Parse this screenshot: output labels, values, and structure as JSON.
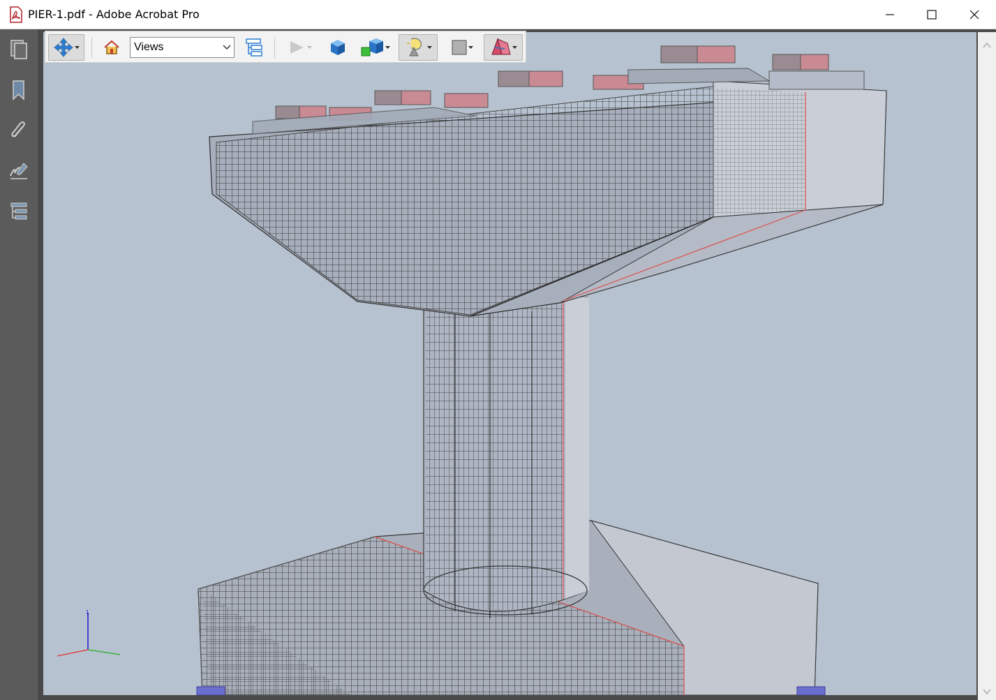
{
  "window": {
    "title": "PIER-1.pdf - Adobe Acrobat Pro",
    "controls": [
      "minimize",
      "maximize",
      "close"
    ]
  },
  "left_nav": {
    "items": [
      {
        "name": "page-thumbnails",
        "icon": "pages-icon"
      },
      {
        "name": "bookmarks",
        "icon": "bookmark-icon"
      },
      {
        "name": "attachments",
        "icon": "paperclip-icon"
      },
      {
        "name": "signatures",
        "icon": "signature-icon"
      },
      {
        "name": "model-tree",
        "icon": "model-tree-icon"
      }
    ]
  },
  "toolbar3d": {
    "views_select": {
      "value": "Views"
    },
    "tools": [
      {
        "name": "rotate-pan-tool",
        "icon": "move-arrows-icon",
        "pressed": true
      },
      {
        "name": "default-view",
        "icon": "home-icon"
      },
      {
        "name": "toggle-model-tree",
        "icon": "model-tree-icon"
      },
      {
        "name": "play-animation",
        "icon": "play-icon",
        "disabled": true
      },
      {
        "name": "projection",
        "icon": "cube-icon"
      },
      {
        "name": "render-mode",
        "icon": "render-cube-icon"
      },
      {
        "name": "lighting",
        "icon": "lamp-icon",
        "pressed": true
      },
      {
        "name": "background-color",
        "icon": "color-swatch-icon"
      },
      {
        "name": "cross-section",
        "icon": "cross-section-icon",
        "pressed": true
      }
    ]
  },
  "viewport": {
    "background_color": "#b7c2d0",
    "axis_triad_label": "1"
  }
}
